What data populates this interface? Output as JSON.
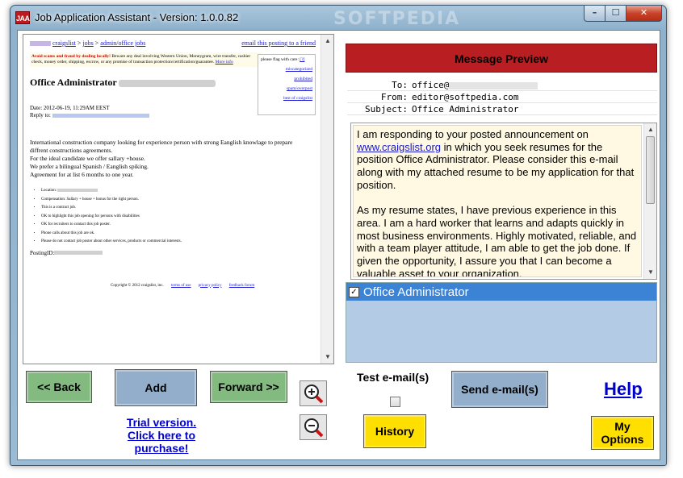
{
  "window": {
    "title": "Job Application Assistant - Version: 1.0.0.82",
    "icon_text": "JAA",
    "watermark": "SOFTPEDIA",
    "controls": {
      "minimize": "–",
      "maximize": "☐",
      "close": "✕"
    }
  },
  "browser": {
    "crumbs": {
      "site": "craigslist",
      "sep1": " > ",
      "jobs": "jobs",
      "sep2": " > ",
      "category": "admin/office jobs",
      "email_link": "email this posting to a friend"
    },
    "warning": {
      "lead": "Avoid scams and fraud by dealing locally!",
      "text": " Beware any deal involving Western Union, Moneygram, wire transfer, cashier check, money order, shipping, escrow, or any promise of transaction protection/certification/guarantee. ",
      "more": "More info"
    },
    "flag_box": {
      "header": "please flag with care:",
      "help": "[?]",
      "flags": [
        "miscategorized",
        "prohibited",
        "spam/overpost",
        "best of craigslist"
      ]
    },
    "job_title": "Office Administrator",
    "date_line": "Date: 2012-06-19, 11:29AM EEST",
    "reply_label": "Reply to:",
    "description": [
      "International construction company looking for experience person with strong Eanglish knowlage to prepare diffrent constructions agreements.",
      "For the ideal candidate we offer sallary +house.",
      "We prefer a bilingual Spanish / Eanglish spiking.",
      "Agreement for at list 6 months to one year."
    ],
    "bullets": [
      "Location:",
      "Compensation: Sallary + house + bonus for the right person.",
      "This is a contract job.",
      "OK to highlight this job opening for persons with disabilities",
      "OK for recruiters to contact this job poster.",
      "Phone calls about this job are ok.",
      "Please do not contact job poster about other services, products or commercial interests."
    ],
    "posting_id_label": "PostingID:",
    "footer": {
      "copyright": "Copyright © 2012 craigslist, inc.",
      "terms": "terms of use",
      "privacy": "privacy policy",
      "feedback": "feedback forum"
    }
  },
  "preview": {
    "header": "Message Preview",
    "to_label": "To:",
    "to_value": "office@",
    "from_label": "From:",
    "from_value": "editor@softpedia.com",
    "subject_label": "Subject:",
    "subject_value": "Office Administrator",
    "body": {
      "p1_before": "I am responding to your posted announcement on ",
      "p1_link": "www.craigslist.org",
      "p1_after": " in which you seek resumes for the position Office Administrator. Please consider this e-mail along with my attached resume to be my application for that position.",
      "p2": "As my resume states, I have previous experience in this area. I am a hard worker that learns and adapts quickly in most business environments. Highly motivated, reliable, and with a team player attitude, I am able to get the job done. If given the opportunity, I assure you that I can become a valuable asset to your organization."
    }
  },
  "list": {
    "items": [
      {
        "label": "Office Administrator",
        "checked": "✓"
      }
    ]
  },
  "controls": {
    "back": "<< Back",
    "add": "Add",
    "forward": "Forward >>",
    "trial": "Trial version. Click here to purchase!",
    "test_label": "Test e-mail(s)",
    "send": "Send e-mail(s)",
    "history": "History",
    "help": "Help",
    "my_options": "My Options"
  },
  "colors": {
    "preview_header": "#b81e22",
    "green_button": "#82ba7f",
    "blue_button": "#93aeca",
    "yellow_button": "#ffdf00",
    "selected_item": "#3c83d6",
    "list_background": "#b3cbe5",
    "body_background": "#fff8e2"
  }
}
